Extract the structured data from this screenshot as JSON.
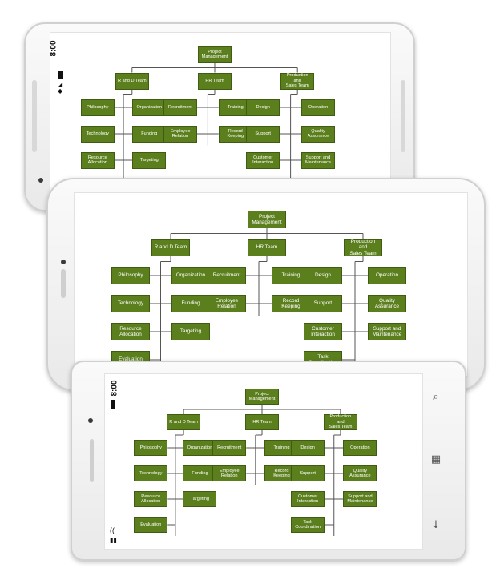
{
  "status_time": "8:00",
  "nodes": {
    "root": "Project\nManagement",
    "rd": "R and D Team",
    "hr": "HR Team",
    "ps": "Production and\nSales Team",
    "philosophy": "Philosophy",
    "organization": "Organization",
    "technology": "Technology",
    "funding": "Funding",
    "resource": "Resource\nAllocation",
    "targeting": "Targeting",
    "evaluation": "Evaluation",
    "recruitment": "Recruitment",
    "training": "Training",
    "employee": "Employee\nRelation",
    "recordkeeping": "Record Keeping",
    "design": "Design",
    "operation": "Operation",
    "support": "Support",
    "quality": "Quality\nAssurance",
    "customer": "Customer\nInteraction",
    "supportmaint": "Support and\nMaintenance",
    "task": "Task\nCoordination"
  },
  "icons": {
    "wifi": "wifi-icon",
    "signal": "signal-icon",
    "battery": "battery-icon",
    "search": "search-icon",
    "windows": "windows-logo-icon",
    "back": "back-arrow-icon"
  },
  "colors": {
    "node_fill": "#5c7f1e",
    "node_border": "#3f5c12",
    "connector": "#555555"
  }
}
